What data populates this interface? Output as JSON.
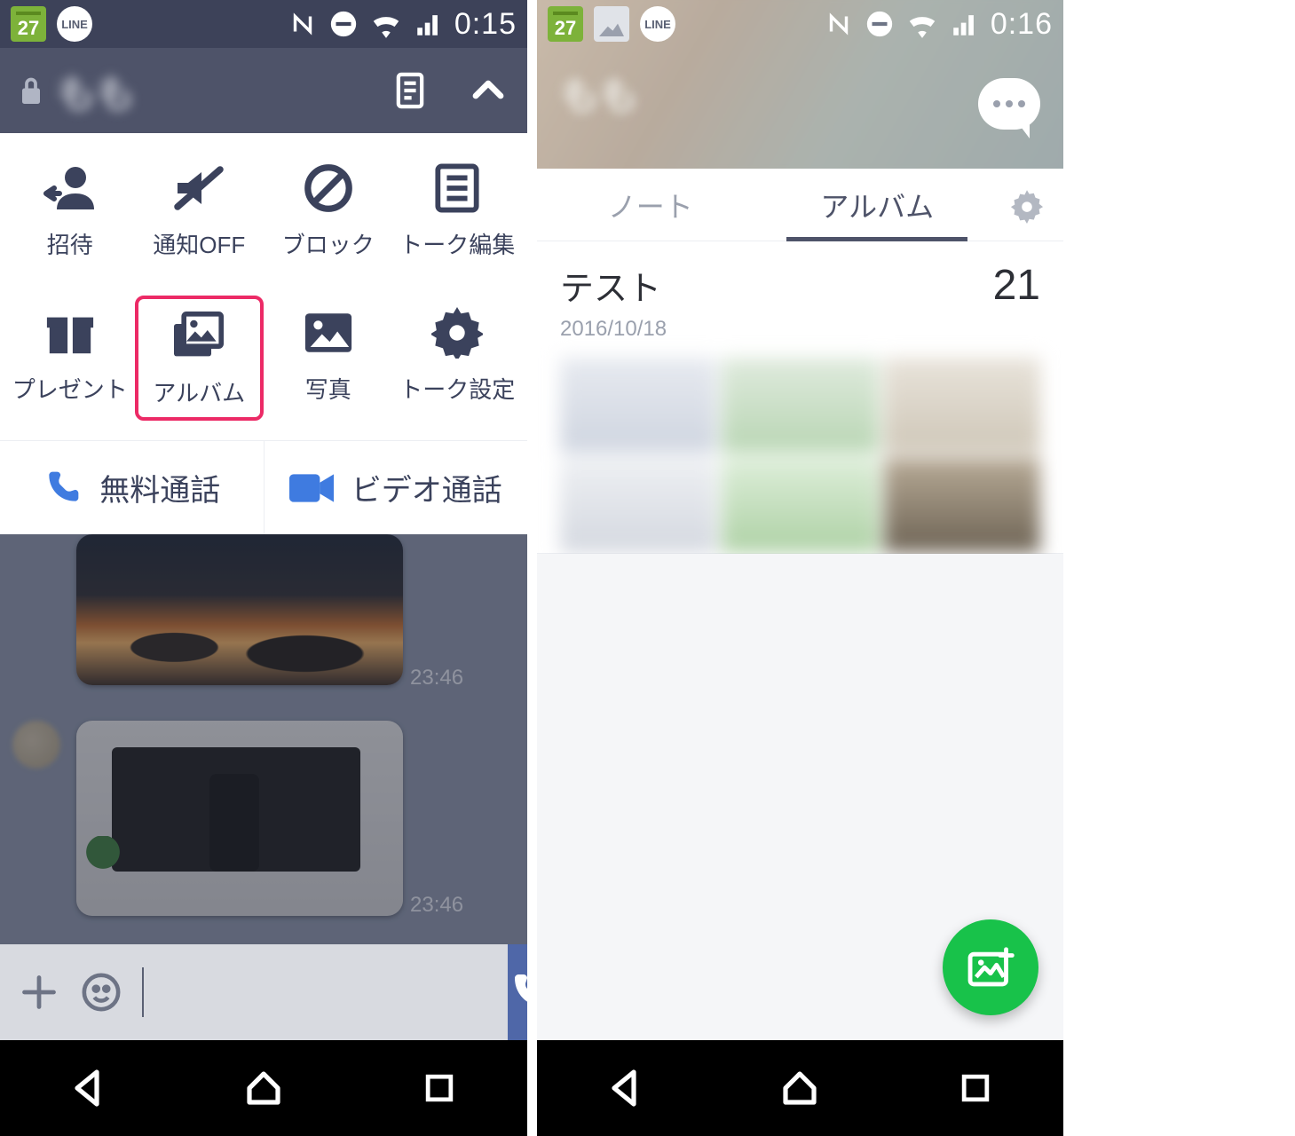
{
  "left": {
    "status": {
      "calendar_day": "27",
      "line_label": "LINE",
      "time": "0:15"
    },
    "chat": {
      "title": "もも"
    },
    "actions": [
      {
        "key": "invite",
        "label": "招待"
      },
      {
        "key": "mute",
        "label": "通知OFF"
      },
      {
        "key": "block",
        "label": "ブロック"
      },
      {
        "key": "edit",
        "label": "トーク編集"
      },
      {
        "key": "present",
        "label": "プレゼント"
      },
      {
        "key": "album",
        "label": "アルバム"
      },
      {
        "key": "photo",
        "label": "写真"
      },
      {
        "key": "settings",
        "label": "トーク設定"
      }
    ],
    "calls": {
      "voice": "無料通話",
      "video": "ビデオ通話"
    },
    "messages": {
      "ts1": "23:46",
      "ts2": "23:46"
    },
    "compose": {
      "placeholder": ""
    }
  },
  "right": {
    "status": {
      "calendar_day": "27",
      "line_label": "LINE",
      "time": "0:16"
    },
    "chat": {
      "title": "もも"
    },
    "tabs": {
      "note": "ノート",
      "album": "アルバム"
    },
    "album": {
      "name": "テスト",
      "date": "2016/10/18",
      "count": "21"
    }
  },
  "colors": {
    "accent_dark": "#3b425c",
    "highlight": "#ec2a66",
    "blue": "#4f67a8",
    "green": "#18c24a"
  }
}
